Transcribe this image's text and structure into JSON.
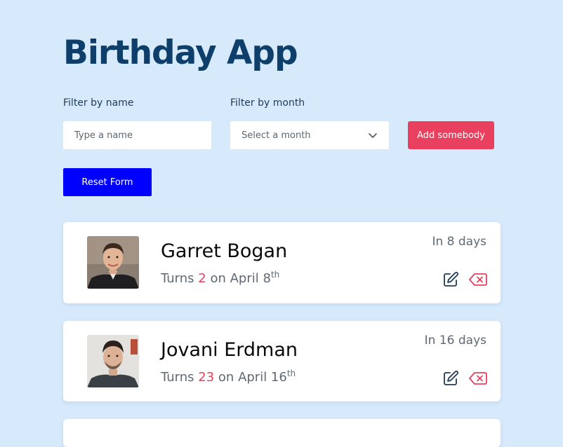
{
  "app": {
    "title": "Birthday App"
  },
  "filters": {
    "name_label": "Filter by name",
    "name_placeholder": "Type a name",
    "month_label": "Filter by month",
    "month_selected": "Select a month"
  },
  "actions": {
    "add_label": "Add somebody",
    "reset_label": "Reset Form"
  },
  "people": [
    {
      "name": "Garret Bogan",
      "turns_prefix": "Turns",
      "age": "2",
      "on_text": "on April 8",
      "ordinal": "th",
      "days": "In 8 days"
    },
    {
      "name": "Jovani Erdman",
      "turns_prefix": "Turns",
      "age": "23",
      "on_text": "on April 16",
      "ordinal": "th",
      "days": "In 16 days"
    }
  ],
  "icons": {
    "select": "chevron-down-icon",
    "edit": "edit-icon",
    "delete": "delete-icon"
  },
  "colors": {
    "background": "#d6eafc",
    "title": "#0e3f6b",
    "accent": "#e9405f",
    "reset": "#0000ff",
    "muted": "#5f6a74"
  }
}
